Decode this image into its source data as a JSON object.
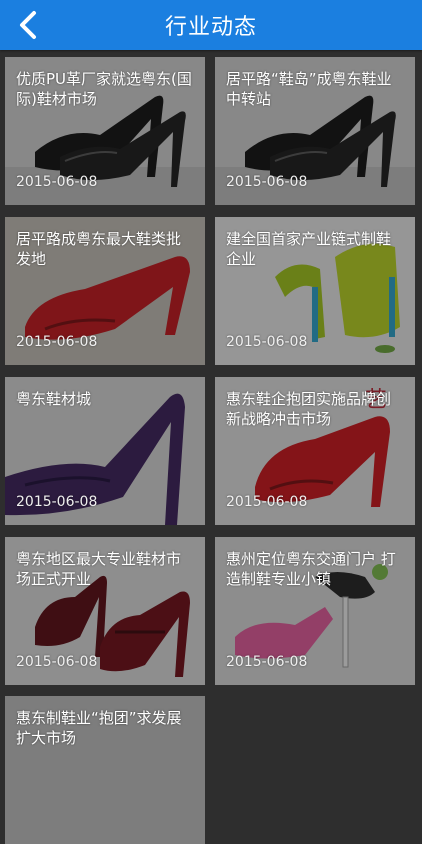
{
  "header": {
    "title": "行业动态"
  },
  "news": [
    {
      "title": "优质PU革厂家就选粤东(国际)鞋材市场",
      "date": "2015-06-08",
      "photo": "black-heel-icon"
    },
    {
      "title": "居平路“鞋岛”成粤东鞋业中转站",
      "date": "2015-06-08",
      "photo": "black-heel-icon"
    },
    {
      "title": "居平路成粤东最大鞋类批发地",
      "date": "2015-06-08",
      "photo": "red-heel-icon"
    },
    {
      "title": "建全国首家产业链式制鞋企业",
      "date": "2015-06-08",
      "photo": "yellow-blue-heel-icon"
    },
    {
      "title": "粤东鞋材城",
      "date": "2015-06-08",
      "photo": "purple-heel-icon"
    },
    {
      "title": "惠东鞋企抱团实施品牌创新战略冲击市场",
      "date": "2015-06-08",
      "photo": "red-heel-icon"
    },
    {
      "title": "粤东地区最大专业鞋材市场正式开业",
      "date": "2015-06-08",
      "photo": "burgundy-heel-icon"
    },
    {
      "title": "惠州定位粤东交通门户 打造制鞋专业小镇",
      "date": "2015-06-08",
      "photo": "pink-heel-icon"
    },
    {
      "title": "惠东制鞋业“抱团”求发展 扩大市场",
      "date": "",
      "photo": ""
    }
  ]
}
